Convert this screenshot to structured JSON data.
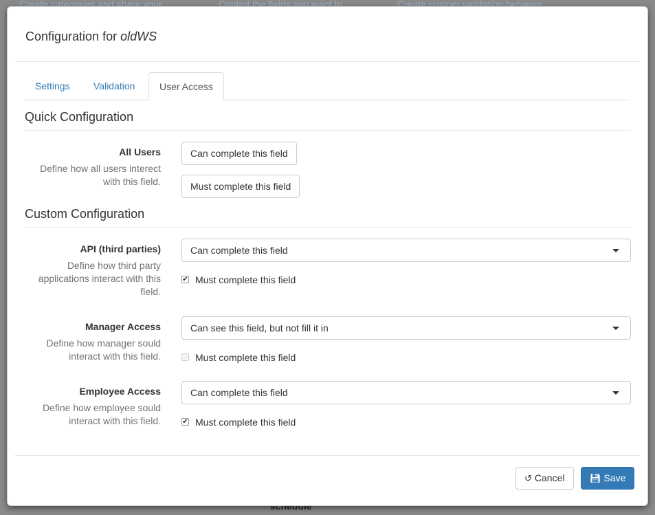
{
  "background": {
    "links": [
      "Create categories and share your",
      "Control the fields you want to",
      "Create custom validation between"
    ],
    "bottom_text": "schedule"
  },
  "modal": {
    "title_prefix": "Configuration for ",
    "title_name": "oldWS",
    "tabs": [
      {
        "label": "Settings",
        "active": false
      },
      {
        "label": "Validation",
        "active": false
      },
      {
        "label": "User Access",
        "active": true
      }
    ]
  },
  "quick": {
    "title": "Quick Configuration",
    "all_users": {
      "label": "All Users",
      "help": "Define how all users interect with this field.",
      "btn_can": "Can complete this field",
      "btn_must": "Must complete this field"
    }
  },
  "custom": {
    "title": "Custom Configuration",
    "rows": [
      {
        "label": "API (third parties)",
        "help": "Define how third party applications interact with this field.",
        "select": "Can complete this field",
        "checkbox_label": "Must complete this field",
        "checked": true,
        "disabled": false
      },
      {
        "label": "Manager Access",
        "help": "Define how manager sould interact with this field.",
        "select": "Can see this field, but not fill it in",
        "checkbox_label": "Must complete this field",
        "checked": false,
        "disabled": true
      },
      {
        "label": "Employee Access",
        "help": "Define how employee sould interact with this field.",
        "select": "Can complete this field",
        "checkbox_label": "Must complete this field",
        "checked": true,
        "disabled": false
      }
    ]
  },
  "footer": {
    "cancel_label": "Cancel",
    "save_label": "Save",
    "cancel_icon": "undo-icon",
    "save_icon": "floppy-disk-icon",
    "primary_color": "#337ab7"
  }
}
